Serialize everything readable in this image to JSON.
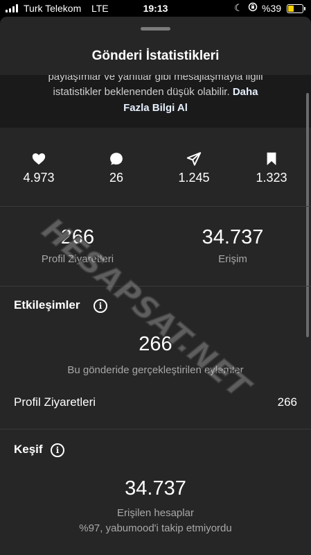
{
  "status_bar": {
    "carrier": "Turk Telekom",
    "network": "LTE",
    "time": "19:13",
    "battery_percent_label": "%39",
    "battery_level": 0.39,
    "battery_color": "#f5d000"
  },
  "sheet": {
    "title": "Gönderi İstatistikleri",
    "notice": {
      "line1": "paylaşımlar ve yanıtlar gibi mesajlaşmayla ilgili",
      "line2_text": "istatistikler beklenenden düşük olabilir.",
      "line2_link": "Daha",
      "line3_link": "Fazla Bilgi Al"
    }
  },
  "metrics": [
    {
      "icon": "heart-icon",
      "value": "4.973"
    },
    {
      "icon": "comment-icon",
      "value": "26"
    },
    {
      "icon": "share-icon",
      "value": "1.245"
    },
    {
      "icon": "bookmark-icon",
      "value": "1.323"
    }
  ],
  "summary": {
    "profile_visits": {
      "value": "266",
      "label": "Profil Ziyaretleri"
    },
    "reach": {
      "value": "34.737",
      "label": "Erişim"
    }
  },
  "interactions": {
    "title": "Etkileşimler",
    "value": "266",
    "subtitle": "Bu gönderide gerçekleştirilen eylemler",
    "rows": [
      {
        "label": "Profil Ziyaretleri",
        "value": "266"
      }
    ]
  },
  "discovery": {
    "title": "Keşif",
    "value": "34.737",
    "subtitle": "Erişilen hesaplar",
    "note": "%97, yabumood'i takip etmiyordu"
  },
  "watermark": "HESAPSAT.NET"
}
